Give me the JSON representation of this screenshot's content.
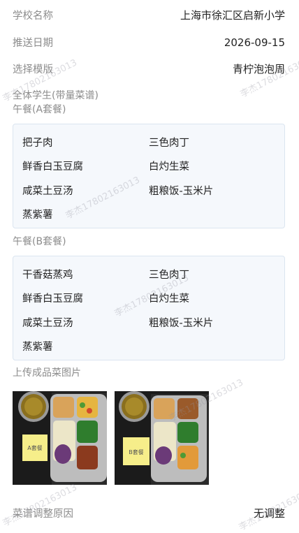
{
  "info": {
    "school_label": "学校名称",
    "school_value": "上海市徐汇区启新小学",
    "date_label": "推送日期",
    "date_value": "2026-09-15",
    "template_label": "选择模版",
    "template_value": "青柠泡泡周"
  },
  "student_label": "全体学生(带量菜谱)",
  "lunch_a": {
    "title": "午餐(A套餐)",
    "items": [
      "把子肉",
      "三色肉丁",
      "鲜香白玉豆腐",
      "白灼生菜",
      "咸菜土豆汤",
      "粗粮饭-玉米片",
      "蒸紫薯"
    ]
  },
  "lunch_b": {
    "title": "午餐(B套餐)",
    "items": [
      "干香菇蒸鸡",
      "三色肉丁",
      "鲜香白玉豆腐",
      "白灼生菜",
      "咸菜土豆汤",
      "粗粮饭-玉米片",
      "蒸紫薯"
    ]
  },
  "upload": {
    "label": "上传成品菜图片",
    "photos": [
      {
        "name": "dish-photo-1",
        "note_text": "A套餐"
      },
      {
        "name": "dish-photo-2",
        "note_text": "B套餐"
      }
    ]
  },
  "adjust": {
    "label": "菜谱调整原因",
    "value": "无调整"
  },
  "watermark_text": "李杰17802163013"
}
